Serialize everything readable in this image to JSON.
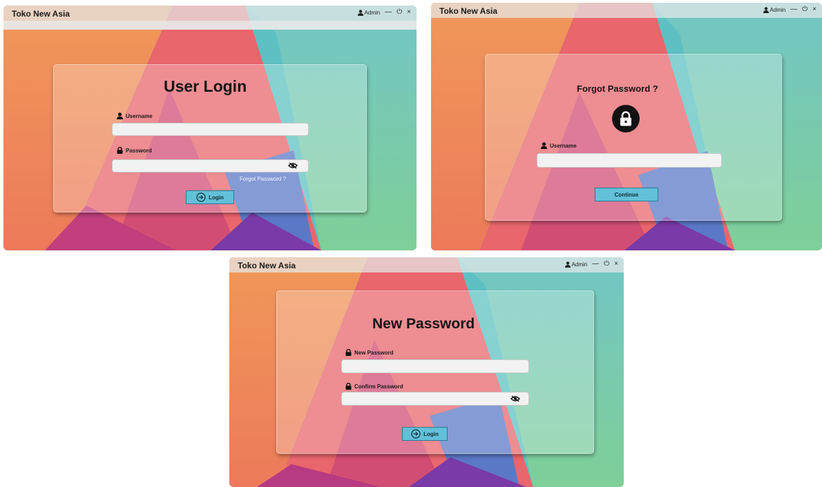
{
  "app_title": "Toko New Asia",
  "window_controls": {
    "user_label": "Admin",
    "minimize": "—",
    "logout": "⏻",
    "close": "×"
  },
  "login_screen": {
    "heading": "User Login",
    "username_label": "Username",
    "password_label": "Password",
    "username_value": "",
    "password_value": "",
    "forgot_link": "Forgot Password ?",
    "login_button": "Login"
  },
  "forgot_screen": {
    "heading": "Forgot Password ?",
    "username_label": "Username",
    "username_value": "",
    "continue_button": "Continue"
  },
  "new_password_screen": {
    "heading": "New Password",
    "new_password_label": "New Password",
    "confirm_password_label": "Confirm Password",
    "new_password_value": "",
    "confirm_password_value": "",
    "login_button": "Login"
  },
  "colors": {
    "accent_button": "#62c0d8",
    "bg_orange": "#ee9356",
    "bg_pink": "#e8646a",
    "bg_teal": "#6cc9bf",
    "bg_green": "#87cf8d",
    "bg_purple": "#8a2c98"
  },
  "icons": [
    "user-icon",
    "lock-icon",
    "eye-slash-icon",
    "login-arrow-icon",
    "minimize-icon",
    "power-icon",
    "close-icon"
  ]
}
